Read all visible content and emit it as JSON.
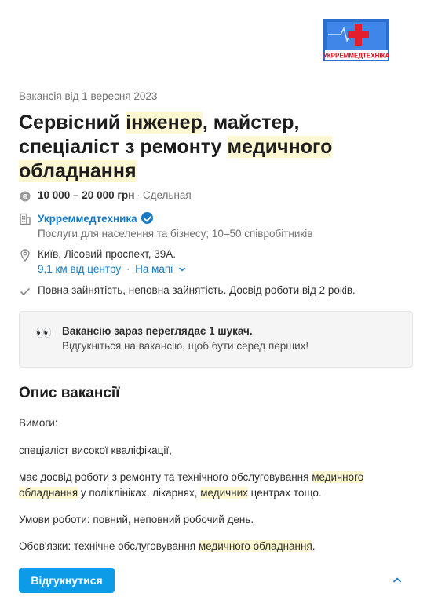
{
  "logo": {
    "text": "УКРРЕММЕДТЕХНІКА"
  },
  "vacancy": {
    "posted": "Вакансія від 1 вересня 2023",
    "title_parts": [
      "Сервісний ",
      "інженер",
      ", майстер, спеціаліст з ремонту ",
      "медичного",
      " ",
      "обладнання"
    ]
  },
  "salary": {
    "amount": "10 000 – 20 000 грн",
    "separator": "·",
    "type": "Сдельная"
  },
  "company": {
    "name": "Укрреммедтехника",
    "description": "Послуги для населення та бізнесу; 10–50 співробітників"
  },
  "location": {
    "address": "Київ, Лісовий проспект, 39А.",
    "distance": "9,1 км від центру",
    "separator": "·",
    "map_link": "На мапі"
  },
  "employment": {
    "text": "Повна зайнятість, неповна зайнятість. Досвід роботи від 2 років."
  },
  "notice": {
    "emoji": "👀",
    "title": "Вакансію зараз переглядає 1 шукач.",
    "subtitle": "Відгукніться на вакансію, щоб бути серед перших!"
  },
  "description": {
    "heading": "Опис вакансії",
    "requirements_label": "Вимоги:",
    "req1": "спеціаліст високої кваліфікації,",
    "req2_parts": [
      "має досвід роботи з ремонту та технічного обслуговування ",
      "медичного обладнання",
      " у поліклініках, лікарнях, ",
      "медичних",
      " центрах тощо."
    ],
    "conditions": "Умови роботи: повний, неповний робочий день.",
    "duties_parts": [
      "Обов'язки: технічне обслуговування ",
      "медичного обладнання",
      "."
    ]
  },
  "actions": {
    "apply_label": "Відгукнутися"
  },
  "colors": {
    "accent": "#0d9ae6",
    "link": "#1479c2",
    "highlight": "#fdf8d2"
  },
  "icons": [
    "coin-icon",
    "building-icon",
    "verified-icon",
    "location-pin-icon",
    "chevron-down-icon",
    "check-icon",
    "chevron-up-icon"
  ]
}
